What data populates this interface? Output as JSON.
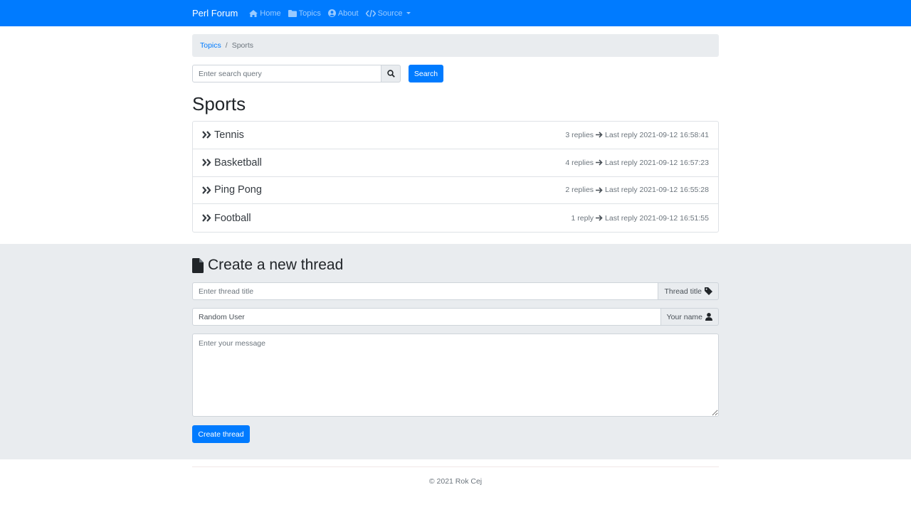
{
  "navbar": {
    "brand": "Perl Forum",
    "links": [
      {
        "label": "Home",
        "icon": "home-icon"
      },
      {
        "label": "Topics",
        "icon": "folder-icon"
      },
      {
        "label": "About",
        "icon": "user-circle-icon"
      },
      {
        "label": "Source",
        "icon": "code-icon"
      }
    ]
  },
  "breadcrumb": {
    "link": "Topics",
    "sep": "/",
    "current": "Sports"
  },
  "search": {
    "placeholder": "Enter search query",
    "button": "Search"
  },
  "page": {
    "title": "Sports"
  },
  "threads": [
    {
      "title": "Tennis",
      "replies": "3 replies",
      "last": "Last reply 2021-09-12 16:58:41"
    },
    {
      "title": "Basketball",
      "replies": "4 replies",
      "last": "Last reply 2021-09-12 16:57:23"
    },
    {
      "title": "Ping Pong",
      "replies": "2 replies",
      "last": "Last reply 2021-09-12 16:55:28"
    },
    {
      "title": "Football",
      "replies": "1 reply",
      "last": "Last reply 2021-09-12 16:51:55"
    }
  ],
  "new_thread": {
    "heading": "Create a new thread",
    "title_placeholder": "Enter thread title",
    "title_addon": "Thread title",
    "name_value": "Random User",
    "name_addon": "Your name",
    "message_placeholder": "Enter your message",
    "submit": "Create thread"
  },
  "footer": {
    "text": "© 2021 Rok Cej"
  },
  "colors": {
    "primary": "#007bff",
    "light": "#e9ecef"
  }
}
